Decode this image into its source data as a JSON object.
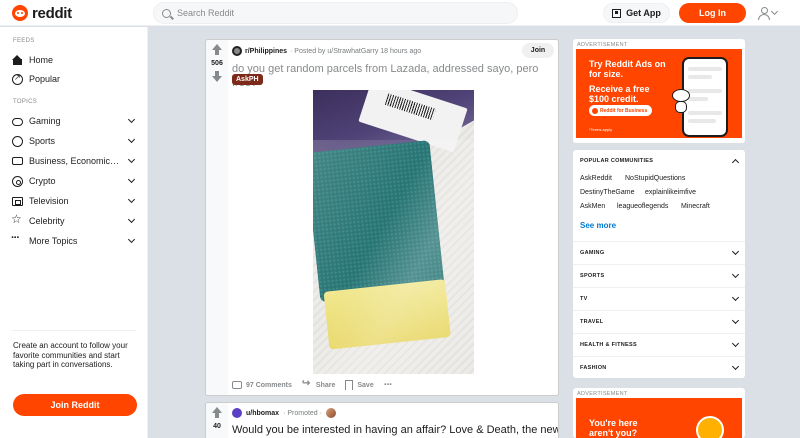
{
  "header": {
    "logo_text": "reddit",
    "search_placeholder": "Search Reddit",
    "get_app_label": "Get App",
    "login_label": "Log In"
  },
  "sidebar": {
    "feeds_heading": "FEEDS",
    "feeds": [
      {
        "label": "Home",
        "icon": "home-icon"
      },
      {
        "label": "Popular",
        "icon": "popular-icon"
      }
    ],
    "topics_heading": "TOPICS",
    "topics": [
      {
        "label": "Gaming",
        "icon": "gaming-icon"
      },
      {
        "label": "Sports",
        "icon": "sports-icon"
      },
      {
        "label": "Business, Economics, a...",
        "icon": "business-icon"
      },
      {
        "label": "Crypto",
        "icon": "crypto-icon"
      },
      {
        "label": "Television",
        "icon": "television-icon"
      },
      {
        "label": "Celebrity",
        "icon": "celebrity-icon"
      },
      {
        "label": "More Topics",
        "icon": "more-icon"
      }
    ],
    "cta_text": "Create an account to follow your favorite communities and start taking part in conversations.",
    "join_label": "Join Reddit"
  },
  "post": {
    "votes": "506",
    "subreddit": "r/Philippines",
    "posted_by": "· Posted by u/StrawhatGarry 18 hours ago",
    "join_label": "Join",
    "title": "do you get random parcels from Lazada, addressed sayo, pero free?",
    "flair": "AskPH",
    "comments_label": "97 Comments",
    "share_label": "Share",
    "save_label": "Save",
    "more_label": "···"
  },
  "post2": {
    "votes": "40",
    "user": "u/hbomax",
    "promoted": "· Promoted ·",
    "title": "Would you be interested in having an affair? Love & Death, the new"
  },
  "ad1": {
    "label": "ADVERTISEMENT",
    "headline": "Try Reddit Ads on for size.",
    "offer": "Receive a free $100 credit.",
    "pill": "Reddit for Business",
    "fine_print": "*Terms apply"
  },
  "communities": {
    "heading": "POPULAR COMMUNITIES",
    "row1": [
      "AskReddit",
      "NoStupidQuestions"
    ],
    "row2": [
      "DestinyTheGame",
      "explainlikeimfive"
    ],
    "row3": [
      "AskMen",
      "leagueoflegends",
      "Minecraft"
    ],
    "see_more": "See more",
    "categories": [
      "GAMING",
      "SPORTS",
      "TV",
      "TRAVEL",
      "HEALTH & FITNESS",
      "FASHION"
    ]
  },
  "ad2": {
    "label": "ADVERTISEMENT",
    "text": "You're here aren't you? Find"
  },
  "colors": {
    "accent": "#ff4500",
    "link": "#0079d3",
    "background": "#dae0e6",
    "flair": "#7d2a1a"
  }
}
